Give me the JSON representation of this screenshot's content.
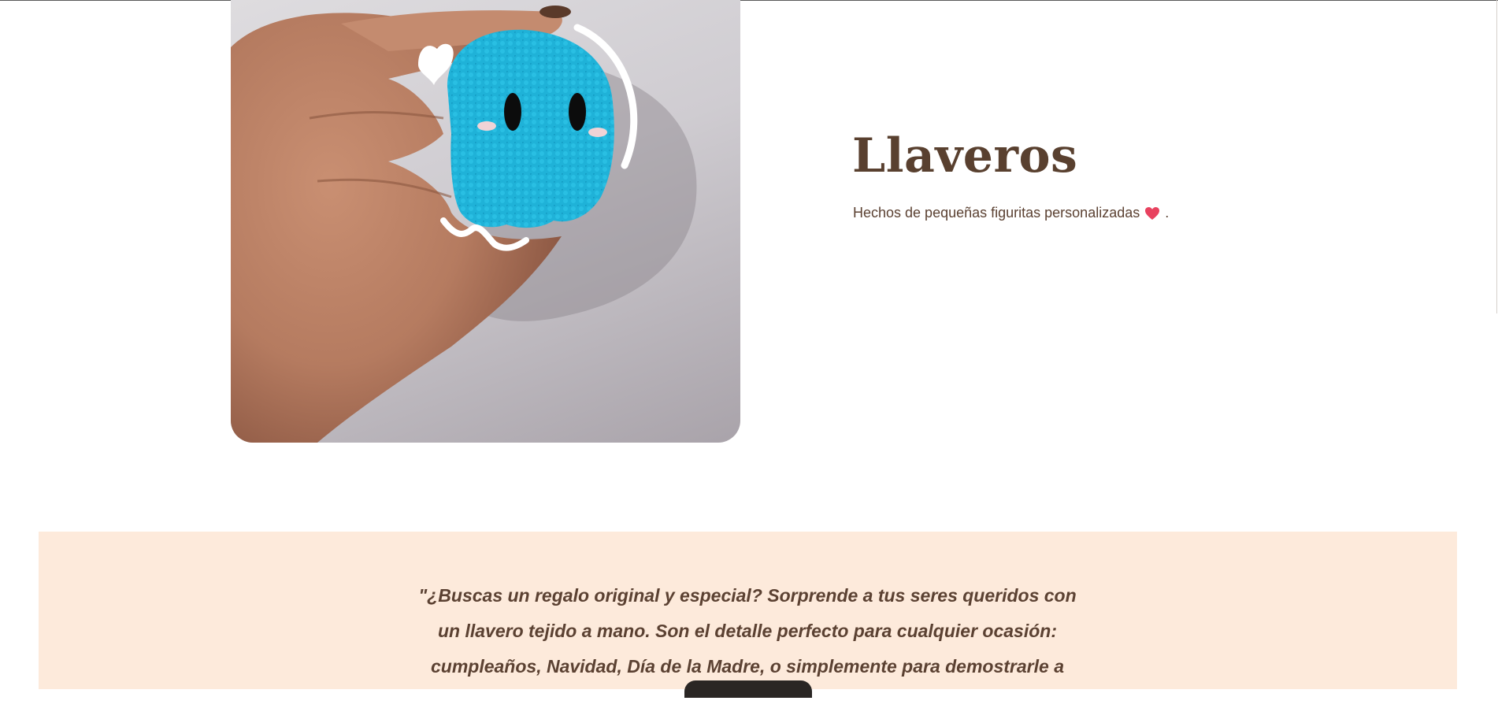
{
  "product": {
    "image_alt": "Llavero tejido de pulpo celeste sostenido en la mano",
    "title": "Llaveros",
    "subtitle": "Hechos de pequeñas figuritas personalizadas",
    "subtitle_end": ".",
    "subtitle_icon": "heart-icon"
  },
  "quote": {
    "text": "\"¿Buscas un regalo original y especial? Sorprende a tus seres queridos con un llavero tejido a mano. Son el detalle perfecto para cualquier ocasión: cumpleaños, Navidad, Día de la Madre, o simplemente para demostrarle a alguien que lo aprecias.\""
  },
  "colors": {
    "title": "#59402f",
    "text": "#5b4132",
    "quote_band": "#fdeadb",
    "heart": "#e8425f",
    "crochet": "#1fb2d8"
  }
}
